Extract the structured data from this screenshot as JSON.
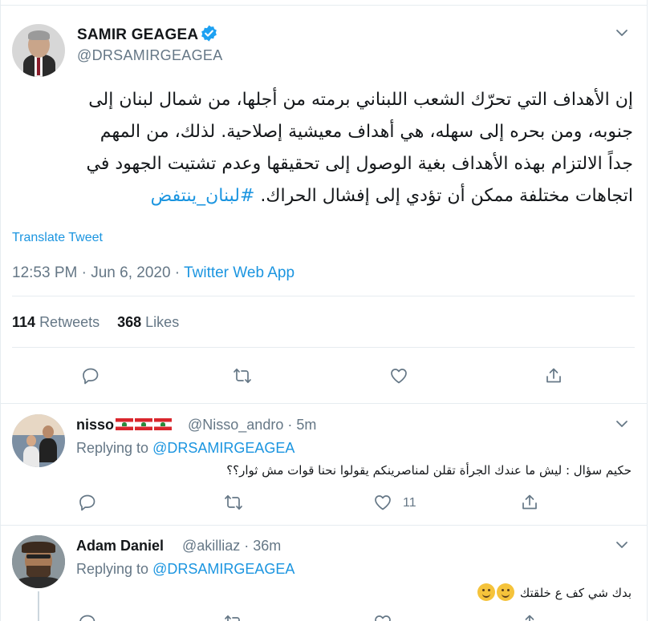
{
  "main_tweet": {
    "author_name": "SAMIR GEAGEA",
    "author_handle": "@DRSAMIRGEAGEA",
    "text_lines": [
      "إن الأهداف التي تحرّك الشعب اللبناني برمته من أجلها، من شمال لبنان إلى",
      "جنوبه، ومن بحره إلى سهله، هي أهداف معيشية إصلاحية. لذلك، من المهم",
      "جداً الالتزام بهذه الأهداف بغية الوصول إلى تحقيقها وعدم تشتيت الجهود في",
      "اتجاهات مختلفة ممكن أن تؤدي إلى إفشال الحراك."
    ],
    "hashtag": "#لبنان_ينتفض",
    "translate_label": "Translate Tweet",
    "time": "12:53 PM · Jun 6, 2020 · ",
    "source_app": "Twitter Web App",
    "retweets_count": "114",
    "retweets_label": "Retweets",
    "likes_count": "368",
    "likes_label": "Likes"
  },
  "replies": [
    {
      "name": "nisso",
      "handle_time": "@Nisso_andro · 5m",
      "replying_prefix": "Replying to ",
      "replying_to": "@DRSAMIRGEAGEA",
      "text": "حكيم سؤال : ليش ما عندك الجرأة تقلن لمناصرينكم يقولوا نحنا قوات مش ثوار؟؟",
      "like_count": "11"
    },
    {
      "name": "Adam Daniel",
      "handle_time": "@akilliaz · 36m",
      "replying_prefix": "Replying to ",
      "replying_to": "@DRSAMIRGEAGEA",
      "text": "بدك شي كف ع خلقتك"
    }
  ],
  "colors": {
    "accent": "#1b95e0",
    "secondary_text": "#657786",
    "divider": "#e6ecf0"
  },
  "icons": [
    "verified-badge-icon",
    "chevron-down-icon",
    "reply-icon",
    "retweet-icon",
    "like-icon",
    "share-icon"
  ]
}
